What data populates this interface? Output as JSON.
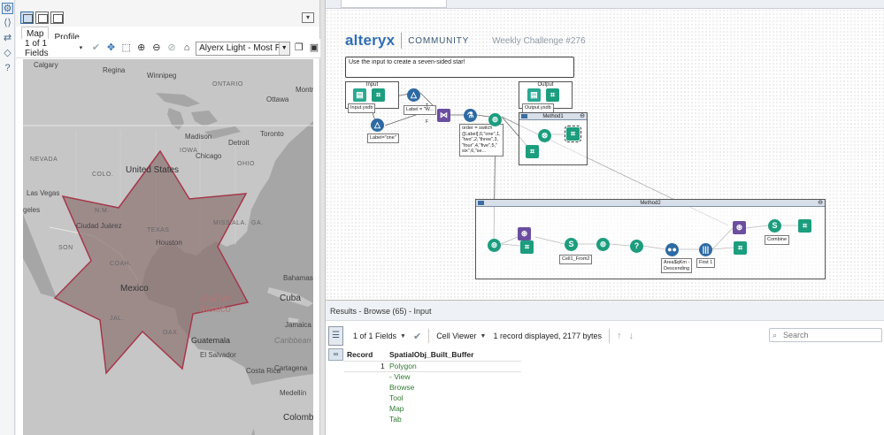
{
  "left_rail": {
    "icons": [
      "configuration-icon",
      "code-icon",
      "connections-icon",
      "tag-icon",
      "help-icon"
    ]
  },
  "browse": {
    "tabs": [
      "Map",
      "Profile"
    ],
    "fields_select": "1 of 1 Fields",
    "map_style": "Alyerx Light - Most Recent",
    "map_labels": {
      "Calgary": "Calgary",
      "Regina": "Regina",
      "Winnipeg": "Winnipeg",
      "ONTARIO": "ONTARIO",
      "Ottawa": "Ottawa",
      "Toronto": "Toronto",
      "Montreal": "Montre",
      "Madison": "Madison",
      "Detroit": "Detroit",
      "Chicago": "Chicago",
      "OHIO": "OHIO",
      "IOWA": "IOWA",
      "NEVADA": "NEVADA",
      "COLO": "COLO.",
      "United_States": "United States",
      "Las_Vegas": "Las Vegas",
      "Angeles": "geles",
      "NM": "N.M.",
      "Ciudad_Juarez": "Ciudad Juárez",
      "TEXAS": "TEXAS",
      "MISS": "MISS.",
      "ALA": "ALA.",
      "GA": "GA.",
      "Houston": "Houston",
      "SON": "SON",
      "COAH": "COAH.",
      "Gulf_of_Mexico": "Gulf of Mexico",
      "Bahamas": "Bahamas",
      "Mexico": "Mexico",
      "Cuba": "Cuba",
      "Jamaica": "Jamaica",
      "Caribbean": "Caribbean",
      "Guatemala": "Guatemala",
      "El_Salvador": "El Salvador",
      "Costa_Rica": "Costa Rica",
      "Cartagena": "Cartagena",
      "Medellin": "Medellín",
      "Colomb": "Colomb",
      "JAL": "JAL.",
      "OAX": "OAX."
    },
    "accent_color": "#2b6cb0",
    "polygon_fill": "#8c7270"
  },
  "canvas": {
    "brand": {
      "logo": "alteryx",
      "community": "COMMUNITY",
      "challenge": "Weekly Challenge #276"
    },
    "comment": "Use the input to create a seven-sided star!",
    "input_box": {
      "title": "Input",
      "tool_label": "Input.yxdb"
    },
    "output_box": {
      "title": "Output",
      "tool_label": "Output.yxdb"
    },
    "method1_title": "Method1",
    "method2_title": "Method2",
    "annotations": {
      "label_one": "Label=\"one\"",
      "label_w": "Label = \"W...",
      "order": "order = switch\n([Label],0,\"one\",1,\n\"two\",2,\"three\",3,\n\"four\",4,\"five\",5,\"\nsix\",6,\"se...",
      "cell_from": "Cell1_From2",
      "area": "Area$qKm -\nDescending",
      "first": "First 1",
      "combine": "Combine"
    },
    "wire_labels": {
      "t": "T",
      "f": "F",
      "u": "U"
    }
  },
  "results": {
    "title": "Results - Browse (65) - Input",
    "fields": "1 of 1 Fields",
    "viewer": "Cell Viewer",
    "record_count": "1 record displayed, 2177 bytes",
    "search_placeholder": "Search",
    "columns": [
      "Record",
      "SpatialObj_Built_Buffer"
    ],
    "rows": [
      {
        "record": "1",
        "value": "Polygon - View Browse Tool Map Tab"
      }
    ],
    "link_color": "#2f7a2f"
  }
}
